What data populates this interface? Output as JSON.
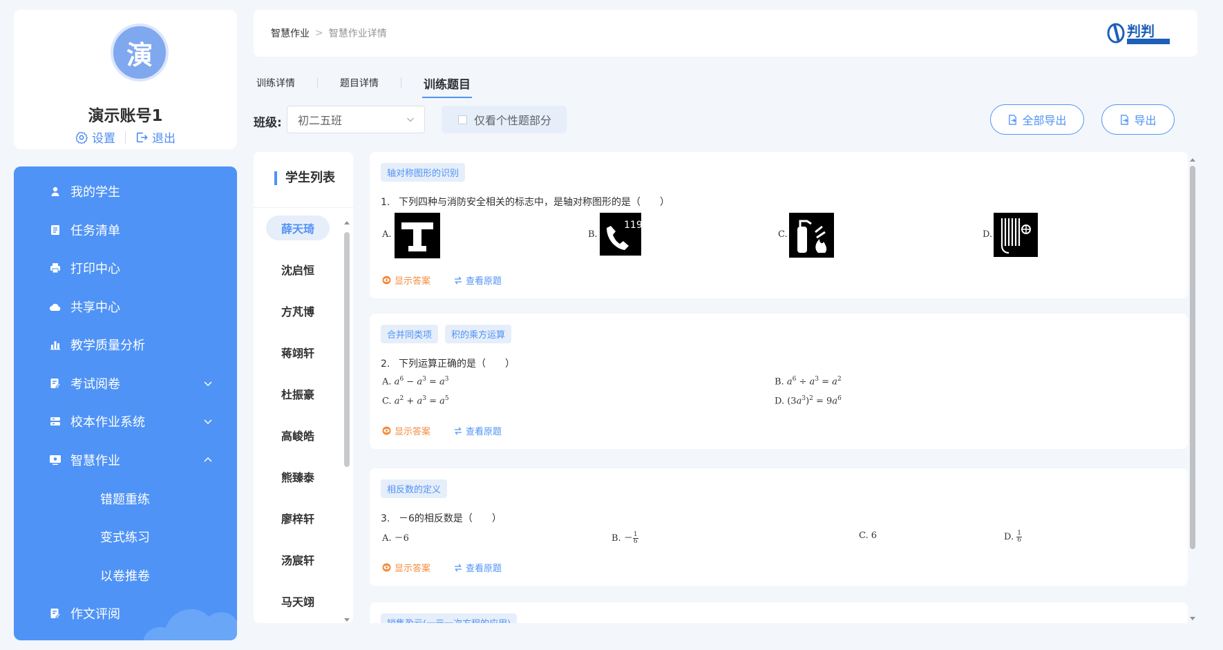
{
  "profile": {
    "avatar_char": "演",
    "name": "演示账号1",
    "settings_label": "设置",
    "logout_label": "退出"
  },
  "menu": {
    "items": [
      {
        "label": "我的学生"
      },
      {
        "label": "任务清单"
      },
      {
        "label": "打印中心"
      },
      {
        "label": "共享中心"
      },
      {
        "label": "教学质量分析"
      },
      {
        "label": "考试阅卷",
        "expanded": false
      },
      {
        "label": "校本作业系统",
        "expanded": false
      },
      {
        "label": "智慧作业",
        "expanded": true
      },
      {
        "label": "错题重练"
      },
      {
        "label": "变式练习"
      },
      {
        "label": "以卷推卷"
      },
      {
        "label": "作文评阅"
      }
    ]
  },
  "breadcrumb": {
    "level1": "智慧作业",
    "separator": ">",
    "level2": "智慧作业详情"
  },
  "logo": {
    "text": "判判"
  },
  "tabs": [
    {
      "label": "训练详情",
      "active": false
    },
    {
      "label": "题目详情",
      "active": false
    },
    {
      "label": "训练题目",
      "active": true
    }
  ],
  "filters": {
    "class_label": "班级:",
    "class_value": "初二五班",
    "personal_only_label": "仅看个性题部分",
    "personal_only_checked": false,
    "export_all_label": "全部导出",
    "export_label": "导出"
  },
  "students": {
    "title": "学生列表",
    "items": [
      "薛天琦",
      "沈启恒",
      "方芃博",
      "蒋翊轩",
      "杜振豪",
      "高峻皓",
      "熊臻泰",
      "廖梓轩",
      "汤宸轩",
      "马天翊"
    ],
    "selected": "薛天琦"
  },
  "questions": [
    {
      "tags": [
        "轴对称图形的识别"
      ],
      "number": "1.",
      "stem": "下列四种与消防安全相关的标志中，是轴对称图形的是（　　）",
      "options": [
        "A.",
        "B.",
        "C.",
        "D."
      ],
      "show_answer": "显示答案",
      "view_original": "查看原题"
    },
    {
      "tags": [
        "合并同类项",
        "积的乘方运算"
      ],
      "number": "2.",
      "stem": "下列运算正确的是（　　）",
      "options": [
        "A.",
        "B.",
        "C.",
        "D."
      ],
      "show_answer": "显示答案",
      "view_original": "查看原题"
    },
    {
      "tags": [
        "相反数的定义"
      ],
      "number": "3.",
      "stem": "－6的相反数是（　　）",
      "options": [
        "A. －6",
        "B. －",
        "C. 6",
        "D."
      ],
      "show_answer": "显示答案",
      "view_original": "查看原题"
    },
    {
      "tags": [
        "销售盈亏(一元一次方程的应用)"
      ]
    }
  ]
}
